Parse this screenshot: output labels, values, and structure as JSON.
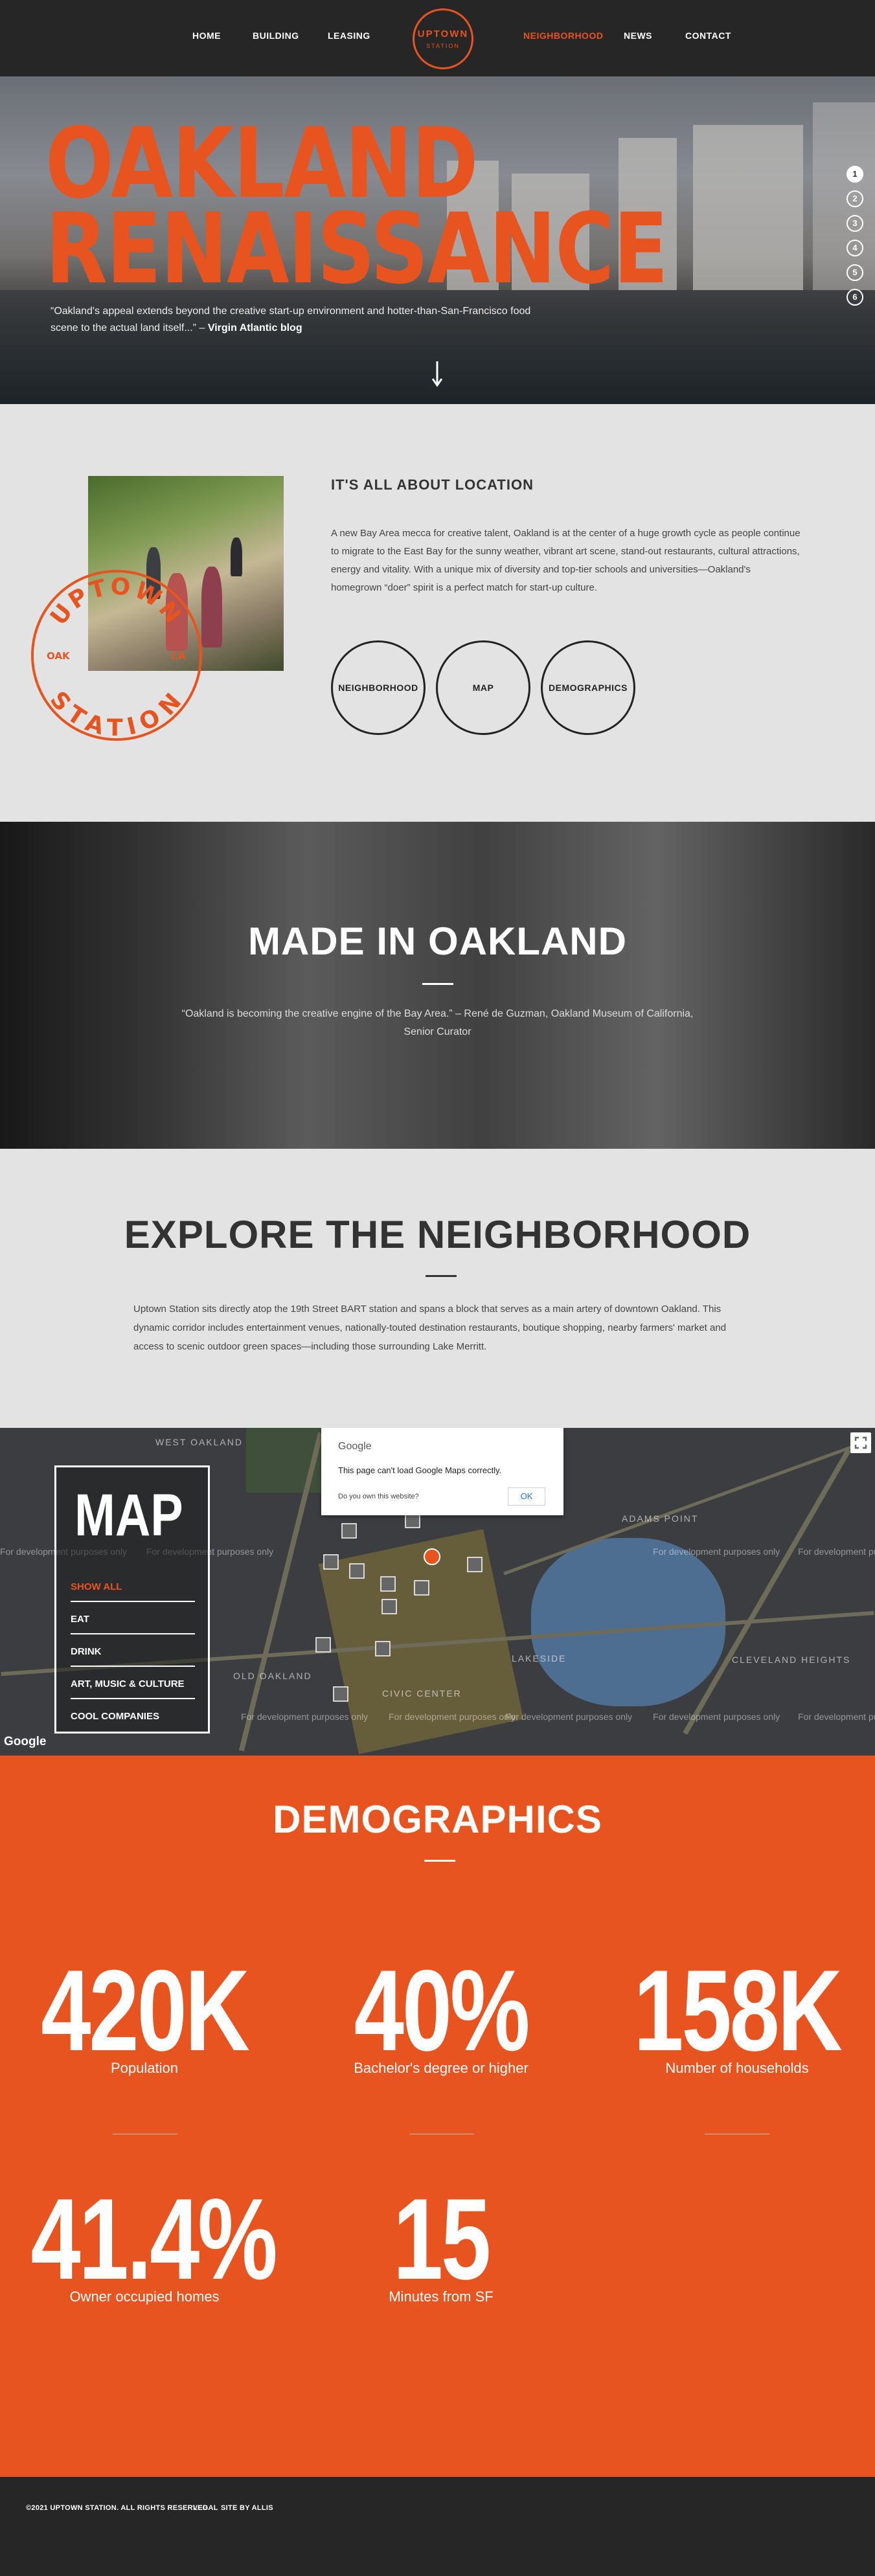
{
  "nav": {
    "left_items": [
      "HOME",
      "BUILDING",
      "LEASING"
    ],
    "logo_top": "UPTOWN",
    "logo_bottom": "STATION",
    "right_items": [
      "NEIGHBORHOOD",
      "NEWS",
      "CONTACT"
    ],
    "active_item": "NEIGHBORHOOD"
  },
  "hero": {
    "title_line1": "OAKLAND",
    "title_line2": "RENAISSANCE",
    "quote": "“Oakland's appeal extends beyond the creative start-up environment and hotter-than-San-Francisco food scene to the actual land itself...” –",
    "quote_source": "Virgin Atlantic blog",
    "section_dots": [
      "1",
      "2",
      "3",
      "4",
      "5",
      "6"
    ],
    "active_dot": "1"
  },
  "location": {
    "heading": "IT'S ALL ABOUT LOCATION",
    "body": "A new Bay Area mecca for creative talent, Oakland is at the center of a huge growth cycle as people continue to migrate to the East Bay for the sunny weather, vibrant art scene, stand-out restaurants, cultural attractions, energy and vitality. With a unique mix of diversity and top-tier schools and universities—Oakland's homegrown “doer” spirit is a perfect match for start-up culture.",
    "buttons": [
      "NEIGHBORHOOD",
      "MAP",
      "DEMOGRAPHICS"
    ],
    "stamp": {
      "top": "UPTOWN",
      "bottom": "STATION",
      "left": "OAK",
      "right": "CA"
    }
  },
  "made": {
    "title": "MADE IN OAKLAND",
    "quote": "“Oakland is becoming the creative engine of the Bay Area.” – René de Guzman, Oakland Museum of California, Senior Curator"
  },
  "explore": {
    "title": "EXPLORE THE NEIGHBORHOOD",
    "body": "Uptown Station sits directly atop the 19th Street BART station and spans a block that serves as a main artery of downtown Oakland. This dynamic corridor includes entertainment venues, nationally-touted destination restaurants, boutique shopping, nearby farmers' market and access to scenic outdoor green spaces—including those surrounding Lake Merritt."
  },
  "map": {
    "panel_title": "MAP",
    "filters": [
      "SHOW ALL",
      "EAT",
      "DRINK",
      "ART, MUSIC & CULTURE",
      "COOL COMPANIES"
    ],
    "active_filter": "SHOW ALL",
    "dialog_brand": "Google",
    "dialog_message": "This page can't load Google Maps correctly.",
    "dialog_own": "Do you own this website?",
    "dialog_ok": "OK",
    "watermark": "For development purposes only",
    "google_mark": "Google",
    "area_labels": [
      "WEST OAKLAND",
      "ADAMS POINT",
      "OLD OAKLAND",
      "LAKESIDE",
      "CLEVELAND HEIGHTS",
      "CIVIC CENTER"
    ]
  },
  "demographics": {
    "title": "DEMOGRAPHICS",
    "stats": [
      {
        "value": "420K",
        "label": "Population"
      },
      {
        "value": "40%",
        "label": "Bachelor's degree or higher"
      },
      {
        "value": "158K",
        "label": "Number of households"
      },
      {
        "value": "41.4%",
        "label": "Owner occupied homes"
      },
      {
        "value": "15",
        "label": "Minutes from SF"
      }
    ]
  },
  "footer": {
    "copyright": "©2021 UPTOWN STATION.  ALL RIGHTS RESERVED.",
    "legal": "LEGAL",
    "credit": "SITE BY ALLIS"
  },
  "colors": {
    "accent": "#e8541f",
    "dark": "#262626",
    "light_bg": "#e3e3e3"
  }
}
